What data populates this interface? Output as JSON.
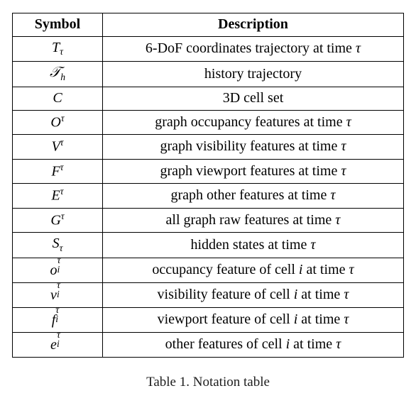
{
  "headers": {
    "symbol": "Symbol",
    "description": "Description"
  },
  "rows": [
    {
      "sym_base": "T",
      "sym_style": "mi",
      "sup": "",
      "sub": "τ",
      "stacked": false,
      "desc_pre": "6-DoF coordinates trajectory at time ",
      "desc_tail_tau": true,
      "desc_mid": "",
      "desc_cell_i": false
    },
    {
      "sym_base": "T",
      "sym_style": "cal",
      "sup": "",
      "sub": "h",
      "stacked": false,
      "desc_pre": "history trajectory",
      "desc_tail_tau": false,
      "desc_mid": "",
      "desc_cell_i": false
    },
    {
      "sym_base": "C",
      "sym_style": "mi",
      "sup": "",
      "sub": "",
      "stacked": false,
      "desc_pre": "3D cell set",
      "desc_tail_tau": false,
      "desc_mid": "",
      "desc_cell_i": false
    },
    {
      "sym_base": "O",
      "sym_style": "mi",
      "sup": "τ",
      "sub": "",
      "stacked": false,
      "desc_pre": "graph occupancy features at time ",
      "desc_tail_tau": true,
      "desc_mid": "",
      "desc_cell_i": false
    },
    {
      "sym_base": "V",
      "sym_style": "mi",
      "sup": "τ",
      "sub": "",
      "stacked": false,
      "desc_pre": "graph visibility features at time ",
      "desc_tail_tau": true,
      "desc_mid": "",
      "desc_cell_i": false
    },
    {
      "sym_base": "F",
      "sym_style": "mi",
      "sup": "τ",
      "sub": "",
      "stacked": false,
      "desc_pre": "graph viewport features at time ",
      "desc_tail_tau": true,
      "desc_mid": "",
      "desc_cell_i": false
    },
    {
      "sym_base": "E",
      "sym_style": "mi",
      "sup": "τ",
      "sub": "",
      "stacked": false,
      "desc_pre": "graph other features at time ",
      "desc_tail_tau": true,
      "desc_mid": "",
      "desc_cell_i": false
    },
    {
      "sym_base": "G",
      "sym_style": "mi",
      "sup": "τ",
      "sub": "",
      "stacked": false,
      "desc_pre": "all graph raw features at time ",
      "desc_tail_tau": true,
      "desc_mid": "",
      "desc_cell_i": false
    },
    {
      "sym_base": "S",
      "sym_style": "mi",
      "sup": "",
      "sub": "τ",
      "stacked": false,
      "desc_pre": "hidden states at time ",
      "desc_tail_tau": true,
      "desc_mid": "",
      "desc_cell_i": false
    },
    {
      "sym_base": "o",
      "sym_style": "mi",
      "sup": "τ",
      "sub": "i",
      "stacked": true,
      "desc_pre": "occupancy feature of cell ",
      "desc_tail_tau": true,
      "desc_mid": " at time ",
      "desc_cell_i": true
    },
    {
      "sym_base": "v",
      "sym_style": "mi",
      "sup": "τ",
      "sub": "i",
      "stacked": true,
      "desc_pre": "visibility feature of cell ",
      "desc_tail_tau": true,
      "desc_mid": " at time ",
      "desc_cell_i": true
    },
    {
      "sym_base": "f",
      "sym_style": "mi",
      "sup": "τ",
      "sub": "i",
      "stacked": true,
      "desc_pre": "viewport feature of cell ",
      "desc_tail_tau": true,
      "desc_mid": " at time ",
      "desc_cell_i": true
    },
    {
      "sym_base": "e",
      "sym_style": "mi",
      "sup": "τ",
      "sub": "i",
      "stacked": true,
      "desc_pre": "other features of cell ",
      "desc_tail_tau": true,
      "desc_mid": " at time ",
      "desc_cell_i": true
    }
  ],
  "caption_prefix": "Table 1. ",
  "caption_text": "Notation table",
  "tau_glyph": "τ",
  "i_glyph": "i",
  "calT_glyph": "𝒯"
}
